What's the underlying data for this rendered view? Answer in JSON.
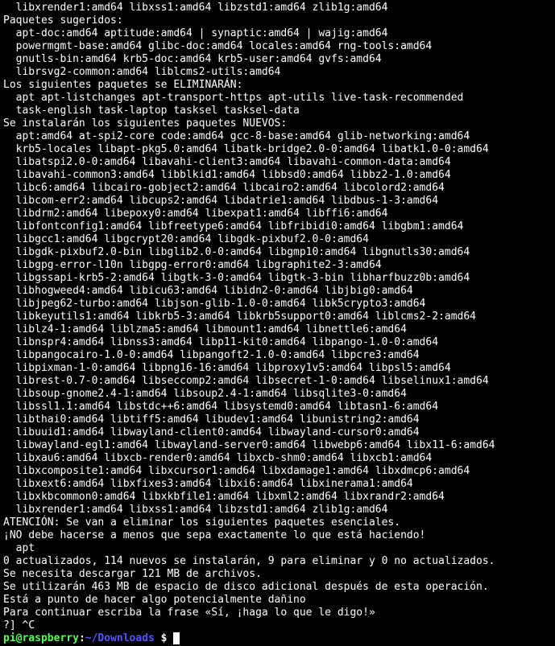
{
  "lines": [
    "  libxrender1:amd64 libxss1:amd64 libzstd1:amd64 zlib1g:amd64",
    "Paquetes sugeridos:",
    "  apt-doc:amd64 aptitude:amd64 | synaptic:amd64 | wajig:amd64",
    "  powermgmt-base:amd64 glibc-doc:amd64 locales:amd64 rng-tools:amd64",
    "  gnutls-bin:amd64 krb5-doc:amd64 krb5-user:amd64 gvfs:amd64",
    "  librsvg2-common:amd64 liblcms2-utils:amd64",
    "Los siguientes paquetes se ELIMINARÁN:",
    "  apt apt-listchanges apt-transport-https apt-utils live-task-recommended",
    "  task-english task-laptop tasksel tasksel-data",
    "Se instalarán los siguientes paquetes NUEVOS:",
    "  apt:amd64 at-spi2-core code:amd64 gcc-8-base:amd64 glib-networking:amd64",
    "  krb5-locales libapt-pkg5.0:amd64 libatk-bridge2.0-0:amd64 libatk1.0-0:amd64",
    "  libatspi2.0-0:amd64 libavahi-client3:amd64 libavahi-common-data:amd64",
    "  libavahi-common3:amd64 libblkid1:amd64 libbsd0:amd64 libbz2-1.0:amd64",
    "  libc6:amd64 libcairo-gobject2:amd64 libcairo2:amd64 libcolord2:amd64",
    "  libcom-err2:amd64 libcups2:amd64 libdatrie1:amd64 libdbus-1-3:amd64",
    "  libdrm2:amd64 libepoxy0:amd64 libexpat1:amd64 libffi6:amd64",
    "  libfontconfig1:amd64 libfreetype6:amd64 libfribidi0:amd64 libgbm1:amd64",
    "  libgcc1:amd64 libgcrypt20:amd64 libgdk-pixbuf2.0-0:amd64",
    "  libgdk-pixbuf2.0-bin libglib2.0-0:amd64 libgmp10:amd64 libgnutls30:amd64",
    "  libgpg-error-l10n libgpg-error0:amd64 libgraphite2-3:amd64",
    "  libgssapi-krb5-2:amd64 libgtk-3-0:amd64 libgtk-3-bin libharfbuzz0b:amd64",
    "  libhogweed4:amd64 libicu63:amd64 libidn2-0:amd64 libjbig0:amd64",
    "  libjpeg62-turbo:amd64 libjson-glib-1.0-0:amd64 libk5crypto3:amd64",
    "  libkeyutils1:amd64 libkrb5-3:amd64 libkrb5support0:amd64 liblcms2-2:amd64",
    "  liblz4-1:amd64 liblzma5:amd64 libmount1:amd64 libnettle6:amd64",
    "  libnspr4:amd64 libnss3:amd64 libp11-kit0:amd64 libpango-1.0-0:amd64",
    "  libpangocairo-1.0-0:amd64 libpangoft2-1.0-0:amd64 libpcre3:amd64",
    "  libpixman-1-0:amd64 libpng16-16:amd64 libproxy1v5:amd64 libpsl5:amd64",
    "  librest-0.7-0:amd64 libseccomp2:amd64 libsecret-1-0:amd64 libselinux1:amd64",
    "  libsoup-gnome2.4-1:amd64 libsoup2.4-1:amd64 libsqlite3-0:amd64",
    "  libssl1.1:amd64 libstdc++6:amd64 libsystemd0:amd64 libtasn1-6:amd64",
    "  libthai0:amd64 libtiff5:amd64 libudev1:amd64 libunistring2:amd64",
    "  libuuid1:amd64 libwayland-client0:amd64 libwayland-cursor0:amd64",
    "  libwayland-egl1:amd64 libwayland-server0:amd64 libwebp6:amd64 libx11-6:amd64",
    "  libxau6:amd64 libxcb-render0:amd64 libxcb-shm0:amd64 libxcb1:amd64",
    "  libxcomposite1:amd64 libxcursor1:amd64 libxdamage1:amd64 libxdmcp6:amd64",
    "  libxext6:amd64 libxfixes3:amd64 libxi6:amd64 libxinerama1:amd64",
    "  libxkbcommon0:amd64 libxkbfile1:amd64 libxml2:amd64 libxrandr2:amd64",
    "  libxrender1:amd64 libxss1:amd64 libzstd1:amd64 zlib1g:amd64",
    "ATENCIÓN: Se van a eliminar los siguientes paquetes esenciales.",
    "¡NO debe hacerse a menos que sepa exactamente lo que está haciendo!",
    "  apt",
    "0 actualizados, 114 nuevos se instalarán, 9 para eliminar y 0 no actualizados.",
    "Se necesita descargar 121 MB de archivos.",
    "Se utilizarán 463 MB de espacio de disco adicional después de esta operación.",
    "Está a punto de hacer algo potencialmente dañino",
    "Para continuar escriba la frase «Sí, ¡haga lo que le digo!»",
    "?] ^C"
  ],
  "prompt": {
    "user": "pi",
    "at": "@",
    "host": "raspberry",
    "colon": ":",
    "path": "~/Downloads",
    "dollar": " $ "
  }
}
